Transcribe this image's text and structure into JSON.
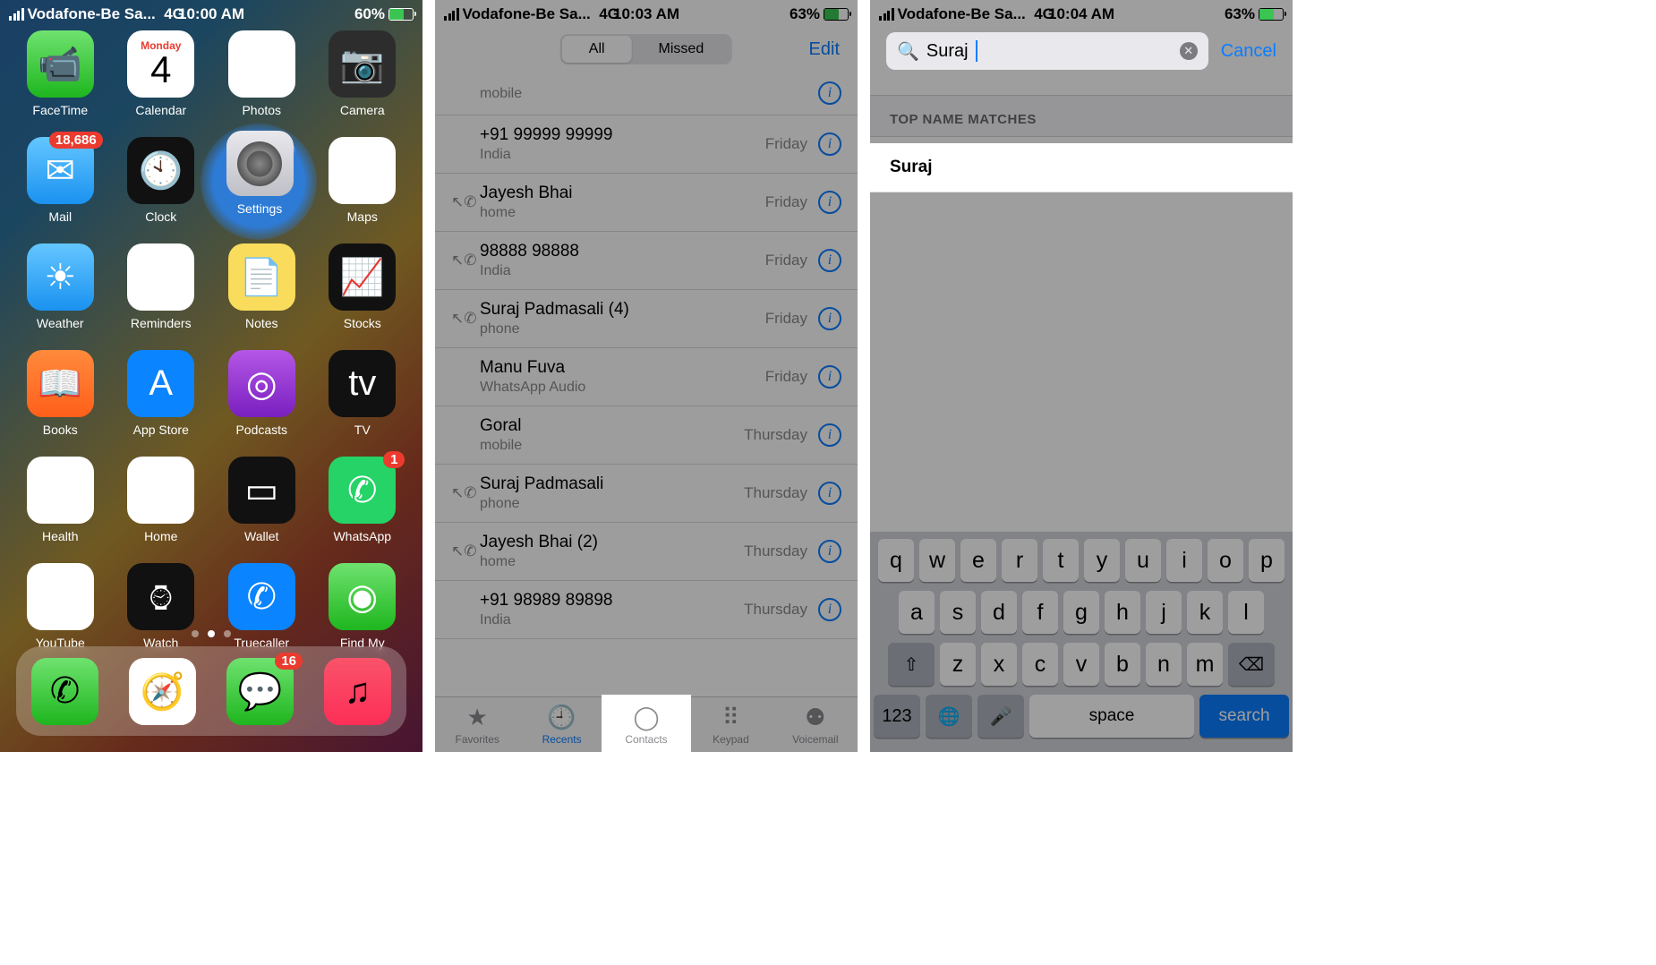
{
  "s1": {
    "carrier": "Vodafone-Be Sa...",
    "net": "4G",
    "time": "10:00 AM",
    "batt": "60%",
    "apps": [
      {
        "n": "FaceTime",
        "cls": "bg-g",
        "g": "📹"
      },
      {
        "n": "Calendar",
        "cls": "bg-w",
        "g": ""
      },
      {
        "n": "Photos",
        "cls": "bg-w",
        "g": "✿"
      },
      {
        "n": "Camera",
        "cls": "bg-gr",
        "g": "📷"
      },
      {
        "n": "Mail",
        "cls": "bg-lb",
        "g": "✉︎",
        "b": "18,686"
      },
      {
        "n": "Clock",
        "cls": "bg-bk",
        "g": "🕙"
      },
      {
        "n": "Settings",
        "cls": "bg-w",
        "g": "⚙︎"
      },
      {
        "n": "Maps",
        "cls": "bg-w",
        "g": "➤"
      },
      {
        "n": "Weather",
        "cls": "bg-lb",
        "g": "☀︎"
      },
      {
        "n": "Reminders",
        "cls": "bg-w",
        "g": "☰"
      },
      {
        "n": "Notes",
        "cls": "bg-yl",
        "g": "📄"
      },
      {
        "n": "Stocks",
        "cls": "bg-bk",
        "g": "📈"
      },
      {
        "n": "Books",
        "cls": "bg-or",
        "g": "📖"
      },
      {
        "n": "App Store",
        "cls": "bg-ap",
        "g": "A"
      },
      {
        "n": "Podcasts",
        "cls": "bg-pu",
        "g": "◎"
      },
      {
        "n": "TV",
        "cls": "bg-bk",
        "g": "tv"
      },
      {
        "n": "Health",
        "cls": "bg-w",
        "g": "♥︎"
      },
      {
        "n": "Home",
        "cls": "bg-w",
        "g": "⌂"
      },
      {
        "n": "Wallet",
        "cls": "bg-bk",
        "g": "▭"
      },
      {
        "n": "WhatsApp",
        "cls": "bg-gn",
        "g": "✆",
        "b": "1"
      },
      {
        "n": "YouTube",
        "cls": "bg-red",
        "g": "▶︎"
      },
      {
        "n": "Watch",
        "cls": "bg-bk",
        "g": "⌚︎"
      },
      {
        "n": "Truecaller",
        "cls": "bg-ap",
        "g": "✆"
      },
      {
        "n": "Find My",
        "cls": "bg-g",
        "g": "◉"
      }
    ],
    "cal_day": "Monday",
    "cal_date": "4",
    "dock": [
      {
        "n": "phone",
        "cls": "bg-g",
        "g": "✆"
      },
      {
        "n": "safari",
        "cls": "bg-w",
        "g": "🧭"
      },
      {
        "n": "messages",
        "cls": "bg-g",
        "g": "💬",
        "b": "16"
      },
      {
        "n": "music",
        "cls": "bg-mu",
        "g": "♫"
      }
    ],
    "settings_label": "Settings"
  },
  "s2": {
    "carrier": "Vodafone-Be Sa...",
    "net": "4G",
    "time": "10:03 AM",
    "batt": "63%",
    "seg_all": "All",
    "seg_missed": "Missed",
    "edit": "Edit",
    "rows": [
      {
        "nm": "",
        "sub": "mobile",
        "when": "",
        "out": false
      },
      {
        "nm": "+91 99999 99999",
        "sub": "India",
        "when": "Friday",
        "out": false
      },
      {
        "nm": "Jayesh Bhai",
        "sub": "home",
        "when": "Friday",
        "out": true
      },
      {
        "nm": "98888 98888",
        "sub": "India",
        "when": "Friday",
        "out": true
      },
      {
        "nm": "Suraj Padmasali (4)",
        "sub": "phone",
        "when": "Friday",
        "out": true
      },
      {
        "nm": "Manu Fuva",
        "sub": "WhatsApp Audio",
        "when": "Friday",
        "out": false
      },
      {
        "nm": "Goral",
        "sub": "mobile",
        "when": "Thursday",
        "out": false
      },
      {
        "nm": "Suraj Padmasali",
        "sub": "phone",
        "when": "Thursday",
        "out": true
      },
      {
        "nm": "Jayesh Bhai (2)",
        "sub": "home",
        "when": "Thursday",
        "out": true
      },
      {
        "nm": "+91 98989 89898",
        "sub": "India",
        "when": "Thursday",
        "out": false
      }
    ],
    "tabs": [
      {
        "l": "Favorites",
        "g": "★"
      },
      {
        "l": "Recents",
        "g": "🕘"
      },
      {
        "l": "Contacts",
        "g": "◯"
      },
      {
        "l": "Keypad",
        "g": "⠿"
      },
      {
        "l": "Voicemail",
        "g": "⚉"
      }
    ]
  },
  "s3": {
    "carrier": "Vodafone-Be Sa...",
    "net": "4G",
    "time": "10:04 AM",
    "batt": "63%",
    "query": "Suraj",
    "cancel": "Cancel",
    "section": "TOP NAME MATCHES",
    "match": "Suraj",
    "kb_rows": [
      [
        "q",
        "w",
        "e",
        "r",
        "t",
        "y",
        "u",
        "i",
        "o",
        "p"
      ],
      [
        "a",
        "s",
        "d",
        "f",
        "g",
        "h",
        "j",
        "k",
        "l"
      ],
      [
        "z",
        "x",
        "c",
        "v",
        "b",
        "n",
        "m"
      ]
    ],
    "kb_123": "123",
    "kb_space": "space",
    "kb_search": "search"
  }
}
